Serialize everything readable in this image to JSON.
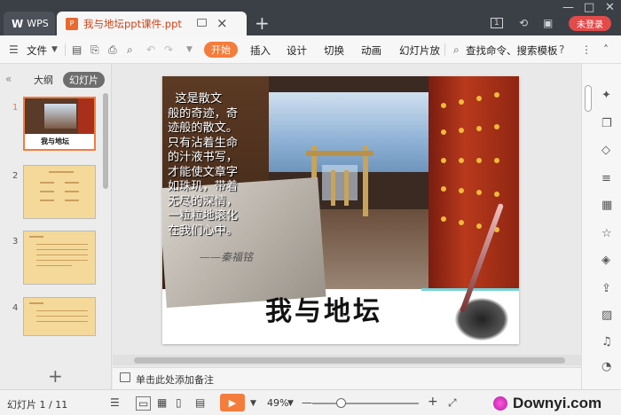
{
  "titlebar": {
    "wps_label": "WPS",
    "doc_tab_label": "我与地坛ppt课件.ppt",
    "doc_tab_mark": "P",
    "new_tab": "+",
    "login_label": "未登录",
    "badge_count": "1"
  },
  "menubar": {
    "file_label": "文件",
    "tabs": [
      "开始",
      "插入",
      "设计",
      "切换",
      "动画",
      "幻灯片放"
    ],
    "search_label": "查找命令、搜索模板"
  },
  "leftpanel": {
    "tab_outline": "大纲",
    "tab_slides": "幻灯片",
    "slide_numbers": [
      "1",
      "2",
      "3",
      "4"
    ],
    "thumb1_title": "我与地坛"
  },
  "slide": {
    "poem": "  这是散文\n般的奇迹，奇\n迹般的散文。\n只有沾着生命\n的汁液书写，\n才能使文章字\n如珠玑，带着\n无尽的深情，\n一粒粒地滚化\n在我们心中。",
    "author": "——秦福铭",
    "title": "我与地坛"
  },
  "notes": {
    "placeholder": "单击此处添加备注"
  },
  "statusbar": {
    "slide_indicator": "幻灯片 1 / 11",
    "zoom": "49%",
    "watermark": "Downyi.com"
  },
  "colors": {
    "accent": "#f47c3c",
    "titlebar_bg": "#3b3f46",
    "login_red": "#e34a4a"
  }
}
